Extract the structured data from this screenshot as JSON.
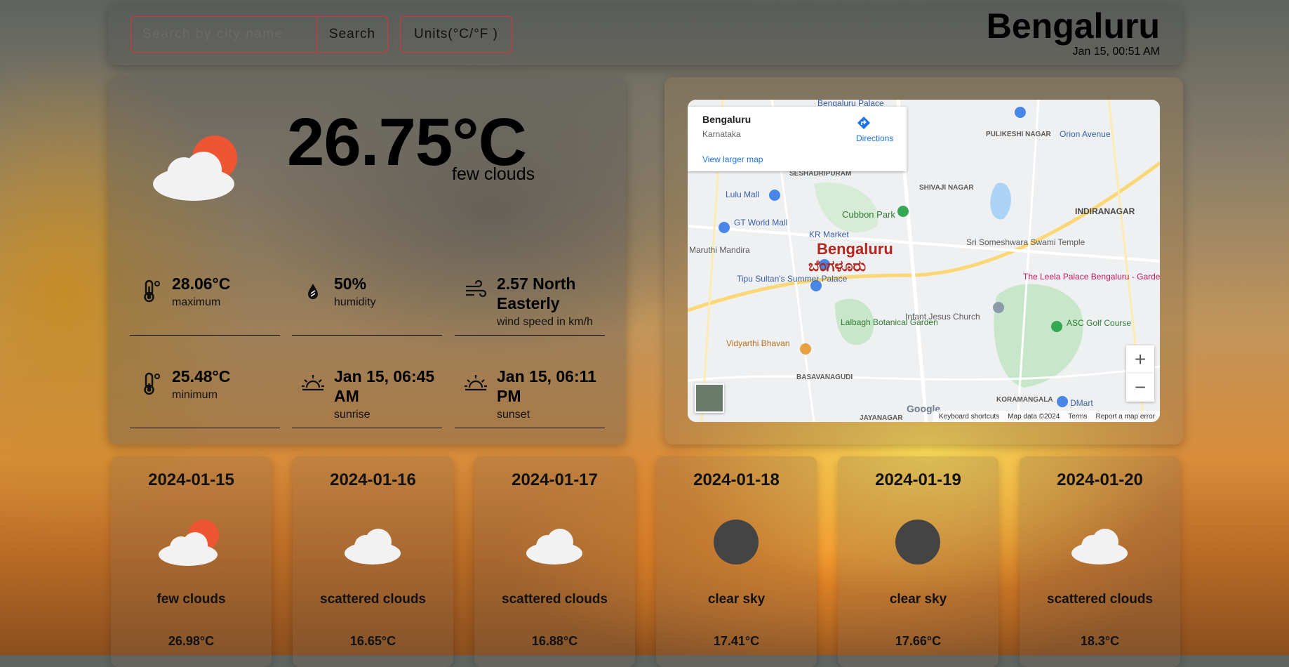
{
  "header": {
    "search_placeholder": "Search by city name",
    "search_label": "Search",
    "units_label": "Units(°C/°F )",
    "city": "Bengaluru",
    "datetime": "Jan 15, 00:51 AM"
  },
  "current": {
    "temperature": "26.75°C",
    "description": "few clouds",
    "icon": "few-clouds-icon",
    "stats": [
      {
        "value": "28.06°C",
        "label": "maximum",
        "icon": "thermometer-icon"
      },
      {
        "value": "50%",
        "label": "humidity",
        "icon": "humidity-drop-icon"
      },
      {
        "value": "2.57 North Easterly",
        "label": "wind speed in km/h",
        "icon": "wind-icon"
      },
      {
        "value": "25.48°C",
        "label": "minimum",
        "icon": "thermometer-icon"
      },
      {
        "value": "Jan 15, 06:45 AM",
        "label": "sunrise",
        "icon": "sunrise-icon"
      },
      {
        "value": "Jan 15, 06:11 PM",
        "label": "sunset",
        "icon": "sunset-icon"
      }
    ]
  },
  "map": {
    "place_title": "Bengaluru",
    "place_subtitle": "Karnataka",
    "directions_label": "Directions",
    "larger_map_label": "View larger map",
    "city_label": "Bengaluru",
    "city_label_local": "ಬೆಂಗಳೂರು",
    "places": {
      "cubbon_park": "Cubbon Park",
      "lulu_mall": "Lulu Mall",
      "gt_world_mall": "GT World Mall",
      "kr_market": "KR Market",
      "maruthi_mandira": "Maruthi Mandira",
      "tipu_palace": "Tipu Sultan's Summer Palace",
      "lalbagh": "Lalbagh Botanical Garden",
      "vidyarthi_bhavan": "Vidyarthi Bhavan",
      "infant_jesus": "Infant Jesus Church",
      "leela_palace": "The Leela Palace Bengaluru - Garden...",
      "asc_golf": "ASC Golf Course",
      "indiranagar": "INDIRANAGAR",
      "orion_avenue": "Orion Avenue",
      "sri_someshwara": "Sri Someshwara Swami Temple",
      "seshadripuram": "SESHADRIPURAM",
      "shivaji_nagar": "SHIVAJI NAGAR",
      "pulikeshi_nagar": "PULIKESHI NAGAR",
      "basavanagudi": "BASAVANAGUDI",
      "jayanagar": "JAYANAGAR",
      "koramangala": "KORAMANGALA",
      "dmart": "DMart",
      "bengaluru_palace": "Bengaluru Palace"
    },
    "footer": {
      "keyboard": "Keyboard shortcuts",
      "map_data": "Map data ©2024",
      "terms": "Terms",
      "report": "Report a map error",
      "google": "Google"
    },
    "zoom_in": "+",
    "zoom_out": "−"
  },
  "forecast": [
    {
      "date": "2024-01-15",
      "description": "few clouds",
      "temp": "26.98°C",
      "icon": "few-clouds-icon"
    },
    {
      "date": "2024-01-16",
      "description": "scattered clouds",
      "temp": "16.65°C",
      "icon": "cloud-icon"
    },
    {
      "date": "2024-01-17",
      "description": "scattered clouds",
      "temp": "16.88°C",
      "icon": "cloud-icon"
    },
    {
      "date": "2024-01-18",
      "description": "clear sky",
      "temp": "17.41°C",
      "icon": "moon-icon"
    },
    {
      "date": "2024-01-19",
      "description": "clear sky",
      "temp": "17.66°C",
      "icon": "moon-icon"
    },
    {
      "date": "2024-01-20",
      "description": "scattered clouds",
      "temp": "18.3°C",
      "icon": "cloud-icon"
    }
  ],
  "colors": {
    "accent_border": "#dd3333",
    "sun": "#ee5533",
    "cloud": "#f2f2f2",
    "moon": "#444444"
  }
}
